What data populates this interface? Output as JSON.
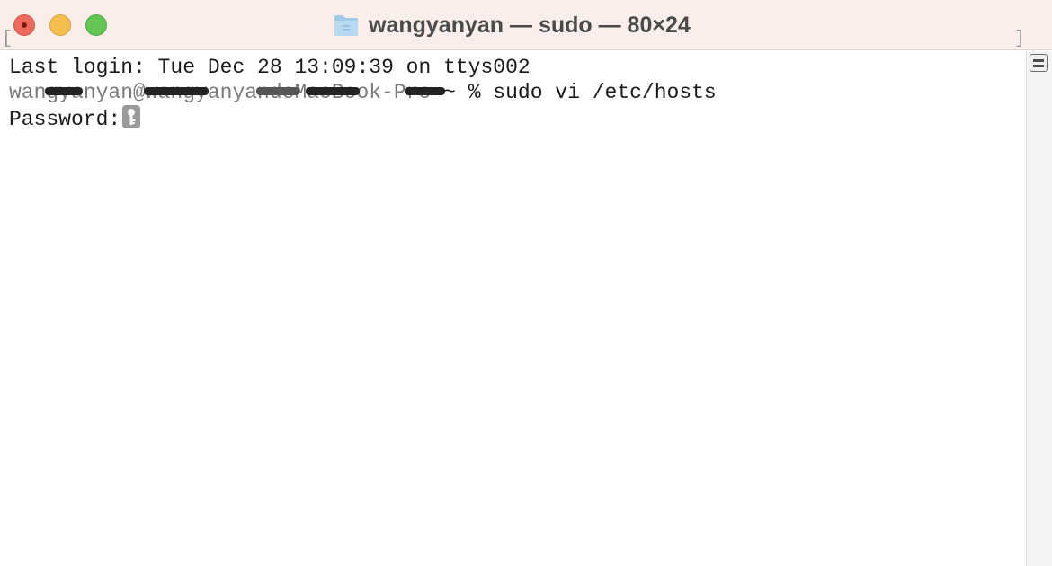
{
  "window": {
    "title": "wangyanyan — sudo — 80×24",
    "controls": {
      "close": "close-button",
      "minimize": "minimize-button",
      "maximize": "maximize-button"
    },
    "title_icon": "folder-icon"
  },
  "terminal": {
    "last_login": "Last login: Tue Dec 28 13:09:39 on ttys002",
    "prompt_redacted": "wangyanyan@wangyanyandeMacBook-Pro",
    "prompt_suffix": " ~ % sudo vi /etc/hosts",
    "password_prompt": "Password:",
    "cursor_icon": "key-icon",
    "bracket_left": "[",
    "bracket_right": "]"
  },
  "scrollbar": {
    "icon": "scroll-menu-icon"
  },
  "colors": {
    "titlebar": "#f9eeea",
    "close": "#ed6a5e",
    "minimize": "#f5bf4f",
    "maximize": "#62c554",
    "text": "#1a1a1a"
  }
}
